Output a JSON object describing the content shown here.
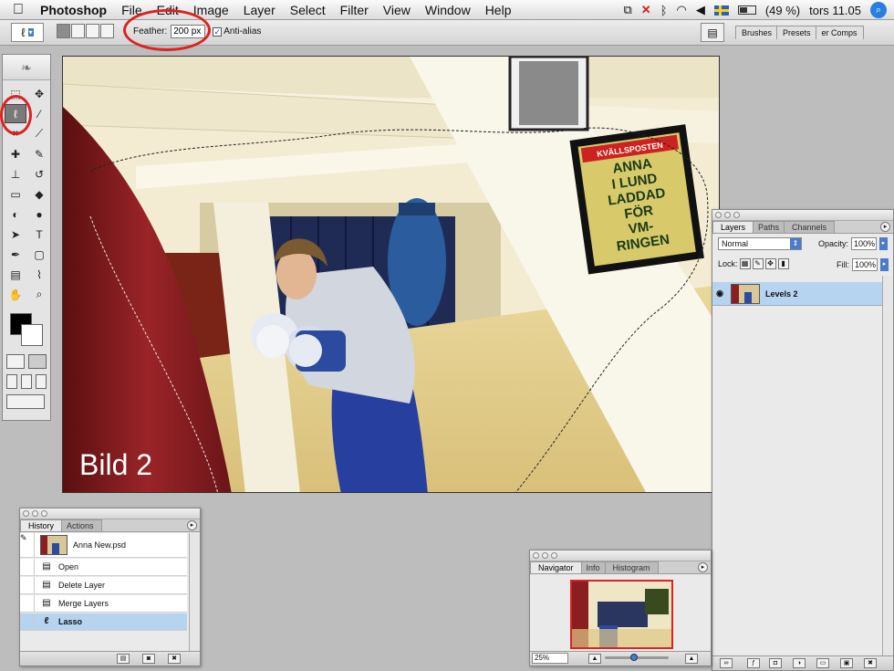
{
  "menubar": {
    "app_name": "Photoshop",
    "items": [
      "File",
      "Edit",
      "Image",
      "Layer",
      "Select",
      "Filter",
      "View",
      "Window",
      "Help"
    ],
    "status_battery": "(49 %)",
    "status_clock": "tors 11.05"
  },
  "options": {
    "feather_label": "Feather:",
    "feather_value": "200 px",
    "antialias_label": "Anti-alias",
    "well_tabs": [
      "Brushes",
      "Presets",
      "er Comps"
    ]
  },
  "canvas": {
    "watermark": "Bild 2",
    "poster_lines": [
      "ANNA",
      "I LUND",
      "LADDAD",
      "FÖR",
      "VM-",
      "RINGEN"
    ],
    "poster_header": "KVÄLLSPOSTEN"
  },
  "layers_panel": {
    "tabs": [
      "Layers",
      "Paths",
      "Channels"
    ],
    "blend_mode": "Normal",
    "opacity_label": "Opacity:",
    "opacity_value": "100%",
    "lock_label": "Lock:",
    "fill_label": "Fill:",
    "fill_value": "100%",
    "layer_name": "Levels 2"
  },
  "history_panel": {
    "tabs": [
      "History",
      "Actions"
    ],
    "snapshot": "Anna New.psd",
    "states": [
      "Open",
      "Delete Layer",
      "Merge Layers",
      "Lasso"
    ]
  },
  "navigator_panel": {
    "tabs": [
      "Navigator",
      "Info",
      "Histogram"
    ],
    "zoom": "25%"
  },
  "colors": {
    "annotation_red": "#d22222",
    "selection_blue": "#b6d3ef",
    "accent_blue": "#4a7cc8"
  }
}
